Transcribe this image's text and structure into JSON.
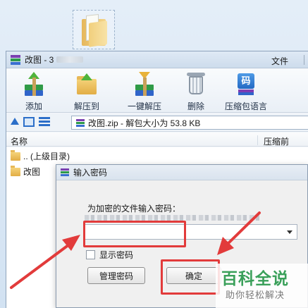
{
  "window": {
    "title": "改图 - 3",
    "menu_file": "文件"
  },
  "toolbar": {
    "add": "添加",
    "extract_to": "解压到",
    "one_key_extract": "一键解压",
    "delete": "删除",
    "language": "压缩包语言"
  },
  "language_icon_glyph": "码",
  "address": {
    "path": "改图.zip - 解包大小为 53.8 KB"
  },
  "columns": {
    "name": "名称",
    "compressed": "压缩前"
  },
  "files": [
    {
      "name": ".. (上级目录)"
    },
    {
      "name": "改图"
    }
  ],
  "dialog": {
    "title": "输入密码",
    "prompt": "为加密的文件输入密码：",
    "password_value": "",
    "show_password": "显示密码",
    "manage_button": "管理密码",
    "ok_button": "确定"
  },
  "watermark": {
    "title": "百科全说",
    "subtitle": "助你轻松解决"
  },
  "colors": {
    "highlight": "#e23b3b",
    "watermark_green": "#3aa05a"
  }
}
